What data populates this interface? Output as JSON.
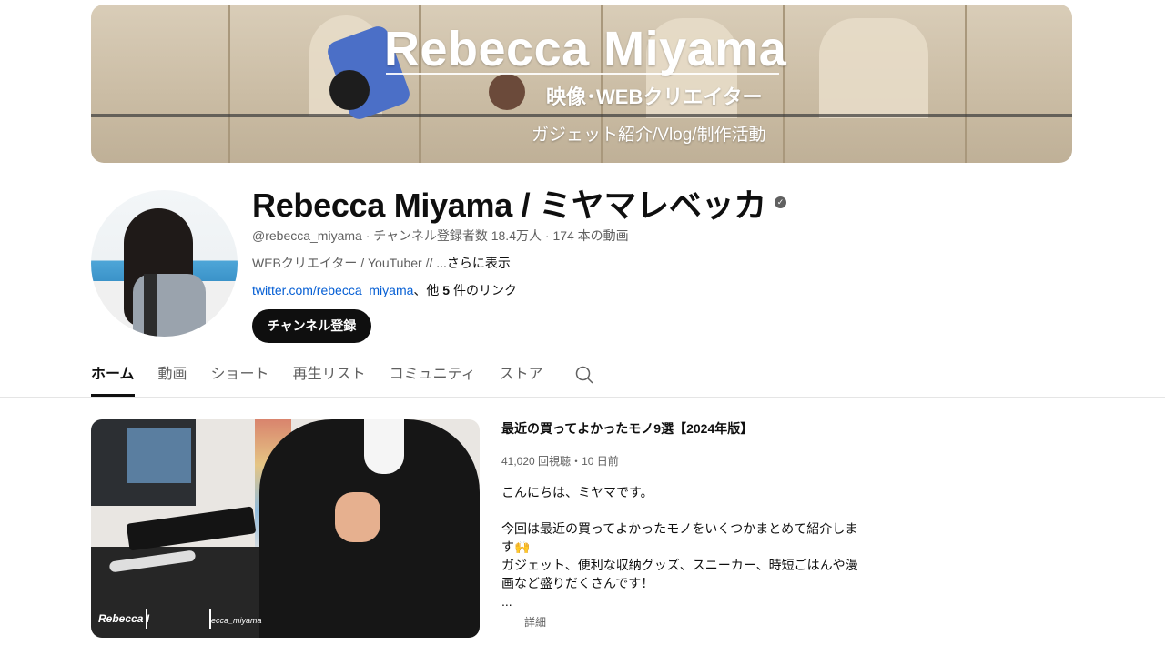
{
  "banner": {
    "title": "Rebecca Miyama",
    "subtitle": "映像･WEBクリエイター",
    "tagline": "ガジェット紹介/Vlog/制作活動"
  },
  "channel": {
    "name": "Rebecca Miyama / ミヤマレベッカ",
    "verified_icon": "verified-check-icon",
    "handle": "@rebecca_miyama",
    "subscribers": "チャンネル登録者数 18.4万人",
    "video_count": "174 本の動画",
    "separator": "·",
    "description": "WEBクリエイター / YouTuber // ",
    "description_more": "...さらに表示",
    "link": "twitter.com/rebecca_miyama",
    "links_other_prefix": "、他 ",
    "links_other_count": "5",
    "links_other_suffix": " 件のリンク",
    "subscribe_label": "チャンネル登録"
  },
  "tabs": [
    {
      "label": "ホーム",
      "active": true
    },
    {
      "label": "動画"
    },
    {
      "label": "ショート"
    },
    {
      "label": "再生リスト"
    },
    {
      "label": "コミュニティ"
    },
    {
      "label": "ストア"
    }
  ],
  "featured_video": {
    "title": "最近の買ってよかったモノ9選【2024年版】",
    "views": "41,020 回視聴",
    "age": "10 日前",
    "meta_separator": "・",
    "description_lines": [
      "こんにちは、ミヤマです。",
      "",
      "今回は最近の買ってよかったモノをいくつかまとめて紹介しま",
      "す🙌",
      "ガジェット、便利な収納グッズ、スニーカー、時短ごはんや漫",
      "画など盛りだくさんです！",
      "..."
    ],
    "details_label": "詳細",
    "thumbnail_watermark_name": "Rebecca I",
    "thumbnail_watermark_handle": "ecca_miyama"
  },
  "colors": {
    "text_primary": "#0f0f0f",
    "text_secondary": "#606060",
    "link": "#065fd4",
    "subscribe_bg": "#0f0f0f"
  }
}
